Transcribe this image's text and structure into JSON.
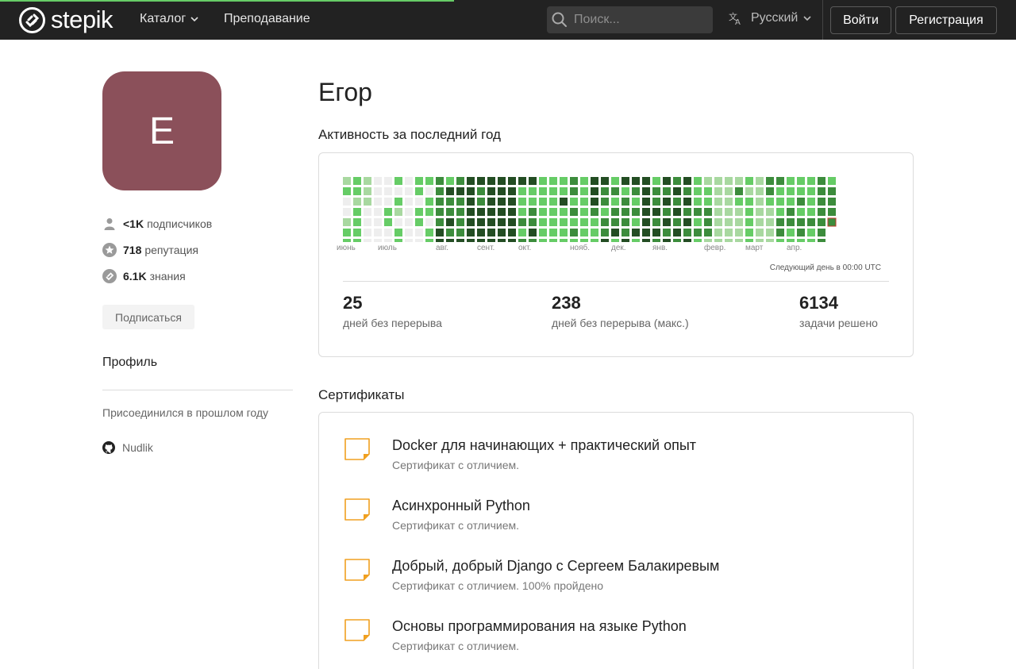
{
  "header": {
    "logo_text": "stepik",
    "nav": [
      {
        "label": "Каталог",
        "has_dropdown": true
      },
      {
        "label": "Преподавание",
        "has_dropdown": false
      }
    ],
    "search": {
      "placeholder": "Поиск..."
    },
    "language": "Русский",
    "login_label": "Войти",
    "register_label": "Регистрация",
    "page_load_progress": 0.447,
    "colors": {
      "bar_bg": "#222222",
      "progress": "#66cc66"
    }
  },
  "profile": {
    "avatar_letter": "Е",
    "avatar_color": "#8b505a",
    "followers_value": "<1K",
    "followers_label": "подписчиков",
    "reputation_value": "718",
    "reputation_label": "репутация",
    "knowledge_value": "6.1K",
    "knowledge_label": "знания",
    "subscribe_label": "Подписаться",
    "profile_tab": "Профиль",
    "joined_text": "Присоединился в прошлом году",
    "github_name": "Nudlik"
  },
  "main": {
    "name": "Егор",
    "activity_title": "Активность за последний год",
    "months": [
      "июнь",
      "июль",
      "авг.",
      "сент.",
      "окт.",
      "нояб.",
      "дек.",
      "янв.",
      "февр.",
      "март",
      "апр."
    ],
    "next_day_note": "Следующий день в 00:00 UTC",
    "stats": [
      {
        "value": "25",
        "label": "дней без перерыва"
      },
      {
        "value": "238",
        "label": "дней без перерыва (макс.)"
      },
      {
        "value": "6134",
        "label": "задачи решено"
      }
    ],
    "heatmap_levels": [
      [
        1,
        3,
        0,
        0,
        1,
        2,
        2,
        2,
        2,
        0
      ],
      [
        3,
        4,
        1,
        2,
        2,
        3,
        3,
        3,
        1,
        0
      ],
      [
        1,
        1,
        1,
        0,
        0,
        0,
        0,
        0,
        1,
        0
      ],
      [
        0,
        0,
        0,
        0,
        0,
        0,
        0,
        0,
        1,
        0
      ],
      [
        0,
        0,
        0,
        4,
        2,
        0,
        0,
        0,
        0,
        0
      ],
      [
        3,
        3,
        2,
        1,
        2,
        2,
        2,
        2,
        2,
        0
      ],
      [
        0,
        0,
        0,
        1,
        0,
        0,
        0,
        0,
        0,
        0
      ],
      [
        4,
        4,
        4,
        4,
        2,
        0,
        0,
        0,
        0,
        0
      ],
      [
        2,
        3,
        3,
        2,
        2,
        2,
        3,
        3,
        2,
        0
      ],
      [
        2,
        2,
        2,
        2,
        2,
        3,
        3,
        2,
        2,
        0
      ],
      [
        1,
        3,
        2,
        2,
        3,
        2,
        3,
        3,
        2,
        0
      ],
      [
        2,
        4,
        2,
        2,
        2,
        2,
        3,
        2,
        2,
        0
      ],
      [
        4,
        4,
        4,
        3,
        4,
        4,
        4,
        4,
        4,
        0
      ],
      [
        3,
        2,
        2,
        3,
        3,
        3,
        3,
        3,
        3,
        0
      ],
      [
        3,
        3,
        3,
        3,
        3,
        3,
        3,
        3,
        3,
        0
      ],
      [
        3,
        3,
        3,
        3,
        3,
        3,
        3,
        3,
        3,
        0
      ],
      [
        3,
        3,
        3,
        3,
        3,
        3,
        3,
        3,
        3,
        0
      ]
    ],
    "heatmap_colors": [
      "#eeeeee",
      "#a8d8a0",
      "#66cc66",
      "#3c8c3c",
      "#234d23"
    ],
    "certificates_title": "Сертификаты",
    "certificates": [
      {
        "title": "Docker для начинающих + практический опыт",
        "subtitle": "Сертификат с отличием."
      },
      {
        "title": "Асинхронный Python",
        "subtitle": "Сертификат с отличием."
      },
      {
        "title": "Добрый, добрый Django с Сергеем Балакиревым",
        "subtitle": "Сертификат с отличием. 100% пройдено"
      },
      {
        "title": "Основы программирования на языке Python",
        "subtitle": "Сертификат с отличием."
      }
    ],
    "cert_icon_color": "#f0a020"
  }
}
